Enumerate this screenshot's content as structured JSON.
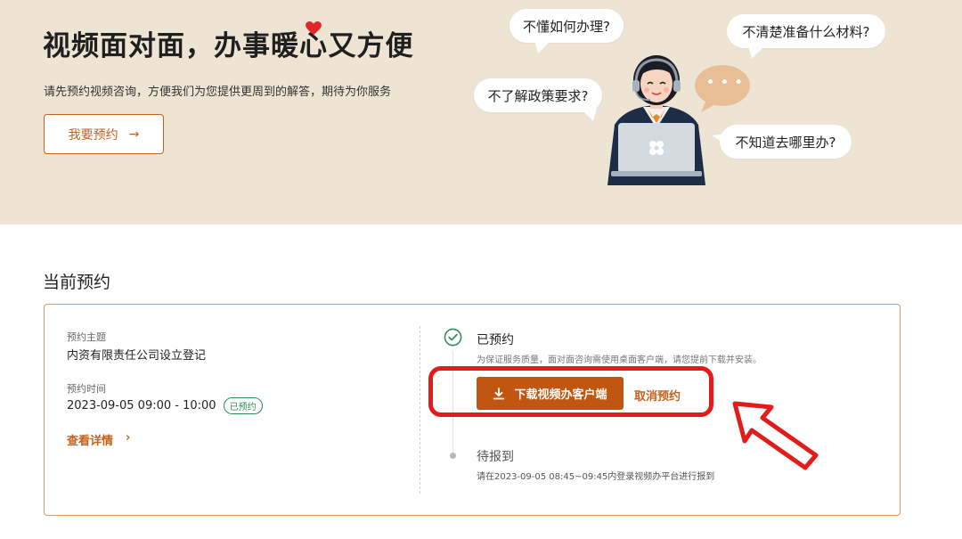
{
  "hero": {
    "title_before": "视频面对面，办事暖",
    "title_heart_char": "心",
    "title_after": "又方便",
    "subtitle": "请先预约视频咨询，方便我们为您提供更周到的解答，期待为你服务",
    "reserve_button": "我要预约",
    "reserve_arrow": "→",
    "bubbles": [
      "不懂如何办理?",
      "不清楚准备什么材料?",
      "不了解政策要求?",
      "不知道去哪里办?"
    ],
    "chat_dots": "• • •"
  },
  "current": {
    "section_title": "当前预约",
    "topic_label": "预约主题",
    "topic_value": "内资有限责任公司设立登记",
    "time_label": "预约时间",
    "time_value": "2023-09-05 09:00 - 10:00",
    "status_badge": "已预约",
    "detail_link": "查看详情",
    "detail_chevron": "›",
    "steps": [
      {
        "title": "已预约",
        "desc": "为保证服务质量，面对面咨询需使用桌面客户端，请您提前下载并安装。"
      },
      {
        "title": "待报到",
        "desc": "请在2023-09-05 08:45~09:45内登录视频办平台进行报到"
      }
    ],
    "download_button": "下载视频办客户端",
    "cancel_link": "取消预约"
  },
  "colors": {
    "hero_bg": "#ede4d4",
    "accent": "#c4611a",
    "download_bg": "#c0560f",
    "success": "#2e8a5a",
    "annotation_red": "#e21b1b",
    "heart": "#e02626"
  }
}
